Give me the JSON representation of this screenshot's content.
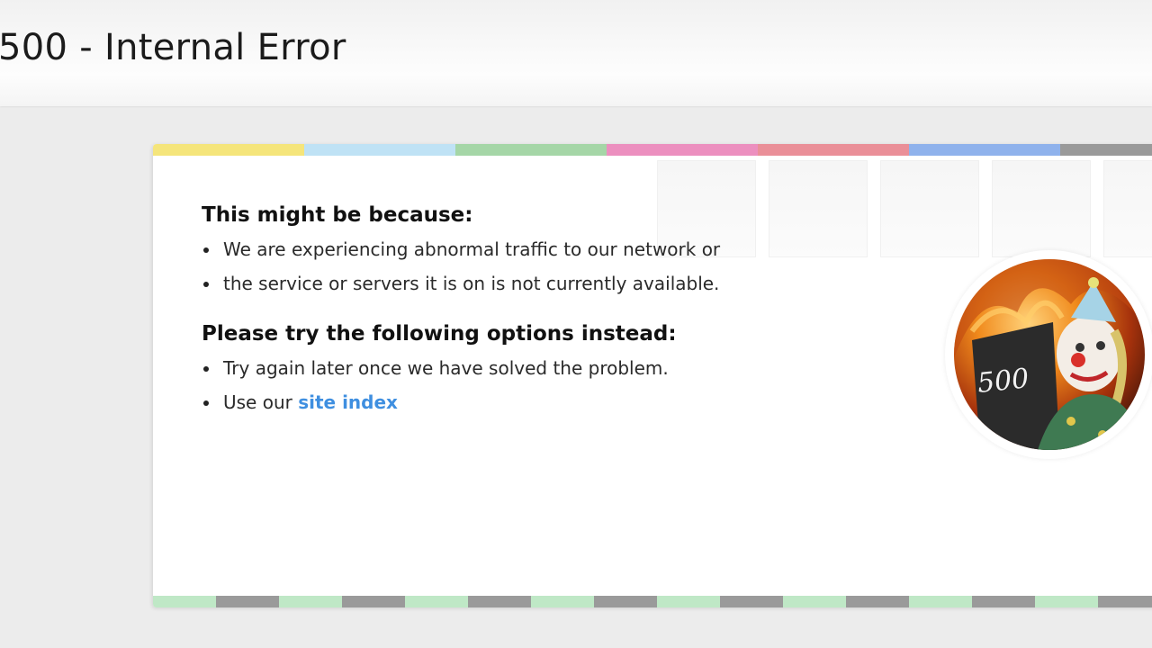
{
  "header": {
    "title": "500 - Internal Error"
  },
  "card": {
    "stripe_colors_top": [
      "#f5e57b",
      "#bfe2f5",
      "#a5d6a7",
      "#ec8fbf",
      "#ea8f98",
      "#8fb2ec",
      "#9a9a9a"
    ],
    "stripe_colors_bottom": [
      "#bfe8c6",
      "#9a9a9a"
    ],
    "section1": {
      "heading": "This might be because:",
      "items": [
        "We are experiencing abnormal traffic to our network or",
        "the service or servers it is on is not currently available."
      ]
    },
    "section2": {
      "heading": "Please try the following options instead:",
      "items": [
        "Try again later once we have solved the problem.",
        "Use our "
      ],
      "link_text": "site index",
      "link_color": "#3f8fe0"
    },
    "illustration": {
      "icon": "clown-fire-500-icon",
      "sign_text": "500"
    }
  }
}
